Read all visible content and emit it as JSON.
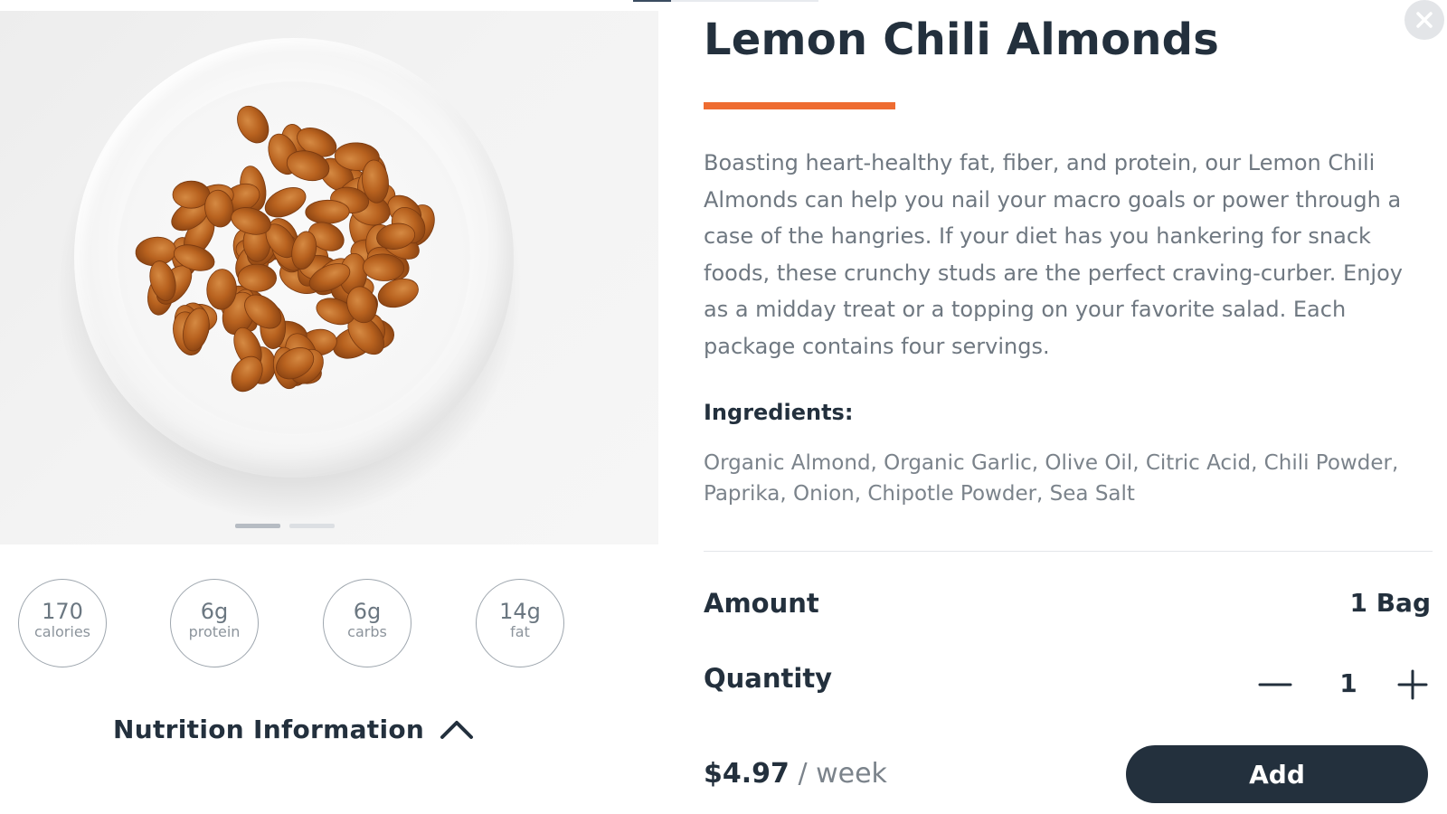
{
  "product": {
    "title": "Lemon Chili Almonds",
    "description": "Boasting heart-healthy fat, fiber, and protein, our Lemon Chili Almonds can help you nail your macro goals or power through a case of the hangries. If your diet has you hankering for snack foods, these crunchy studs are the perfect craving-curber. Enjoy as a midday treat or a topping on your favorite salad. Each package contains four servings.",
    "ingredients_title": "Ingredients:",
    "ingredients": "Organic Almond, Organic Garlic, Olive Oil, Citric Acid, Chili Powder, Paprika, Onion, Chipotle Powder, Sea Salt",
    "image": "bowl of lemon chili almonds"
  },
  "nutrients": [
    {
      "value": "170",
      "label": "calories"
    },
    {
      "value": "6g",
      "label": "protein"
    },
    {
      "value": "6g",
      "label": "carbs"
    },
    {
      "value": "14g",
      "label": "fat"
    }
  ],
  "nutrition_toggle": {
    "label": "Nutrition Information",
    "icon": "chevron-up-icon"
  },
  "carousel": {
    "slides": 2,
    "active_slide": 1
  },
  "amount": {
    "label": "Amount",
    "value": "1 Bag"
  },
  "quantity": {
    "label": "Quantity",
    "value": "1",
    "minus_icon": "minus-icon",
    "plus_icon": "plus-icon"
  },
  "price": {
    "amount": "$4.97",
    "period": " / week"
  },
  "add_button": {
    "label": "Add"
  },
  "close_icon": "close-icon",
  "colors": {
    "primary": "#23303d",
    "accent": "#ee6c31",
    "body_text": "#6f7881",
    "muted": "#7b838b"
  }
}
